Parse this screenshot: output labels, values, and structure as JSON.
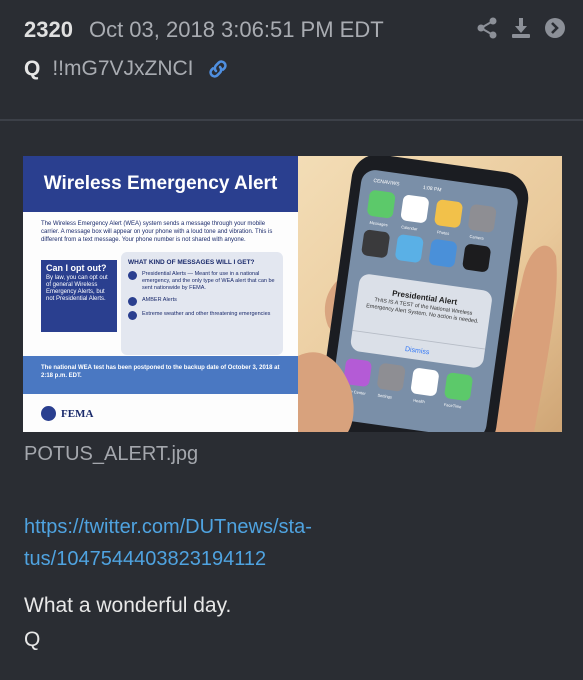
{
  "post": {
    "number": "2320",
    "timestamp": "Oct 03, 2018 3:06:51 PM EDT",
    "author": "Q",
    "tripcode": "!!mG7VJxZNCI"
  },
  "icons": {
    "permalink": "link-icon",
    "share": "share-icon",
    "download": "download-icon",
    "navigate": "arrow-right-circle-icon"
  },
  "image": {
    "filename": "POTUS_ALERT.jpg",
    "title": "Wireless Emergency Alert",
    "intro": "The Wireless Emergency Alert (WEA) system sends a message through your mobile carrier. A message box will appear on your phone with a loud tone and vibration. This is different from a text message. Your phone number is not shared with anyone.",
    "optout_question": "Can I opt out?",
    "optout_answer": "By law, you can opt out of general Wireless Emergency Alerts, but not Presidential Alerts.",
    "info_heading": "WHAT KIND OF MESSAGES WILL I GET?",
    "info_items": [
      "Presidential Alerts — Meant for use in a national emergency, and the only type of WEA alert that can be sent nationwide by FEMA.",
      "AMBER Alerts",
      "Extreme weather and other threatening emergencies"
    ],
    "notice": "The national WEA test has been postponed to the backup date of October 3, 2018 at 2:18 p.m. EDT.",
    "logo_text": "FEMA",
    "phone_carrier": "CENAVIWS",
    "phone_time": "1:08 PM",
    "alert_title": "Presidential Alert",
    "alert_body": "THIS IS A TEST of the National Wireless Emergency Alert System. No action is needed.",
    "alert_dismiss": "Dismiss",
    "app_labels": [
      "Messages",
      "Calendar",
      "Photos",
      "Camera",
      "Videos",
      "Maps",
      "Weather",
      "Wallet",
      "Game Center",
      "Settings",
      "Health",
      "FaceTime"
    ]
  },
  "message": {
    "link": "https://twitter.com/DUTnews/status/1047544403823194112",
    "link_line1": "https://twitter.com/DUTnews/sta-",
    "link_line2": "tus/1047544403823194112",
    "text_line1": "What a wonderful day.",
    "signature": "Q"
  },
  "colors": {
    "background": "#2a2d33",
    "link": "#4fa3e0",
    "muted": "#a9acb2",
    "fema_blue": "#2a3f8f"
  }
}
